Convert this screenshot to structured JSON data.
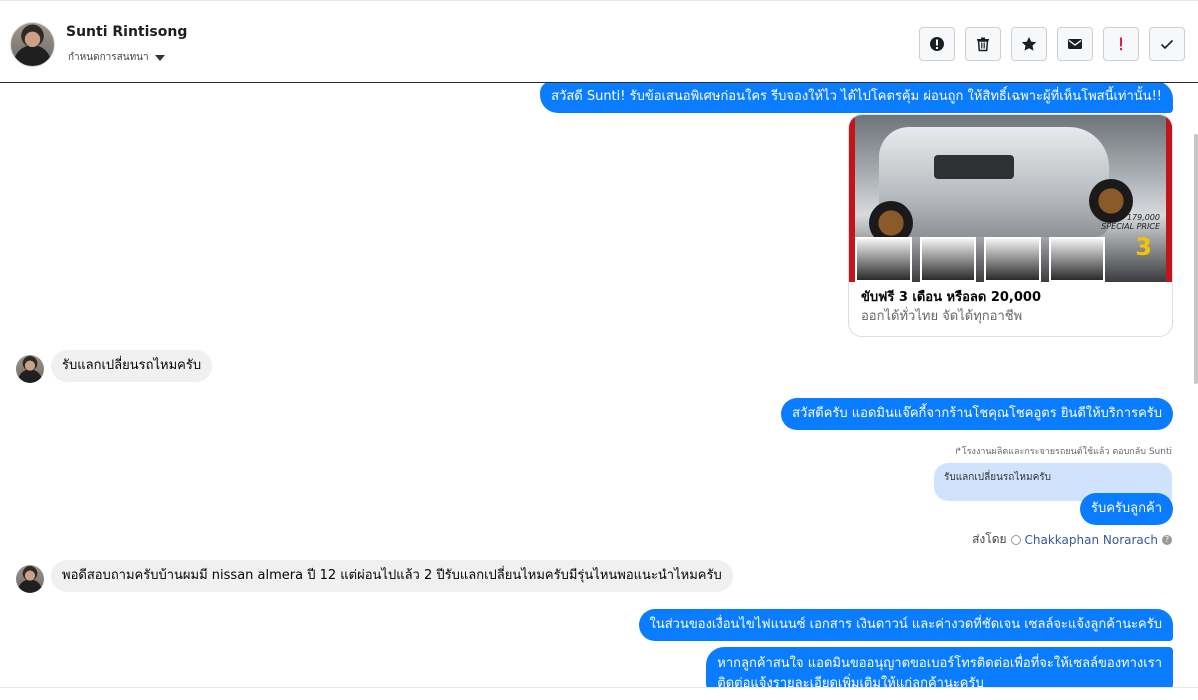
{
  "header": {
    "contact_name": "Sunti Rintisong",
    "assign_label": "กำหนดการสนทนา",
    "actions": [
      {
        "name": "report-spam",
        "icon": "exclamation-circle-icon"
      },
      {
        "name": "delete",
        "icon": "trash-icon"
      },
      {
        "name": "star",
        "icon": "star-icon"
      },
      {
        "name": "mark-unread",
        "icon": "envelope-icon"
      },
      {
        "name": "follow-up",
        "icon": "red-exclamation-icon",
        "color": "#e41e3f"
      },
      {
        "name": "done",
        "icon": "checkmark-icon"
      }
    ]
  },
  "messages": {
    "m1": "สวัสดี Sunti! รับข้อเสนอพิเศษก่อนใคร รีบจองให้ไว ได้ไปโคตรคุ้ม ผ่อนถูก ให้สิทธิ์เฉพาะผู้ที่เห็นโพสนี้เท่านั้น!!",
    "card_title": "ขับฟรี 3 เดือน หรือลด 20,000",
    "card_subtitle": "ออกได้ทั่วไทย จัดได้ทุกอาชีพ",
    "card_price": "179,000",
    "card_price_label": "SPECIAL PRICE",
    "card_badge": "3",
    "m2": "รับแลกเปลี่ยนรถไหมครับ",
    "m3": "สวัสดีครับ แอดมินแจ๊คกี้จากร้านโชคุณโชคอูตร ยินดีให้บริการครับ",
    "reply_note": "โรงงานผลิตและกระจายรถยนต์ใช้แล้ว ตอบกลับ Sunti",
    "quoted": "รับแลกเปลี่ยนรถไหมครับ",
    "m4": "รับครับลูกค้า",
    "sent_by_label": "ส่งโดย",
    "sent_by_agent": "Chakkaphan Norarach",
    "m5": "พอดีสอบถามครับบ้านผมมี nissan almera ปี 12 แต่ผ่อนไปแล้ว 2 ปีรับแลกเปลี่ยนไหมครับมีรุ่นไหนพอแนะนำไหมครับ",
    "m6": "ในส่วนของเงื่อนไขไฟแนนซ์ เอกสาร เงินดาวน์ และค่างวดที่ชัดเจน เซลล์จะแจ้งลูกค้านะครับ",
    "m7_line1": "หากลูกค้าสนใจ แอดมินขออนุญาตขอเบอร์โทรติดต่อเพื่อที่จะให้เซลล์ของทางเรา",
    "m7_line2": "ติดต่อแจ้งรายละเอียดเพิ่มเติมให้แก่ลูกค้านะครับ"
  },
  "colors": {
    "outgoing_bubble": "#0a7cff",
    "incoming_bubble": "#f0f0f0",
    "quoted_bubble": "#cfe3fd"
  }
}
